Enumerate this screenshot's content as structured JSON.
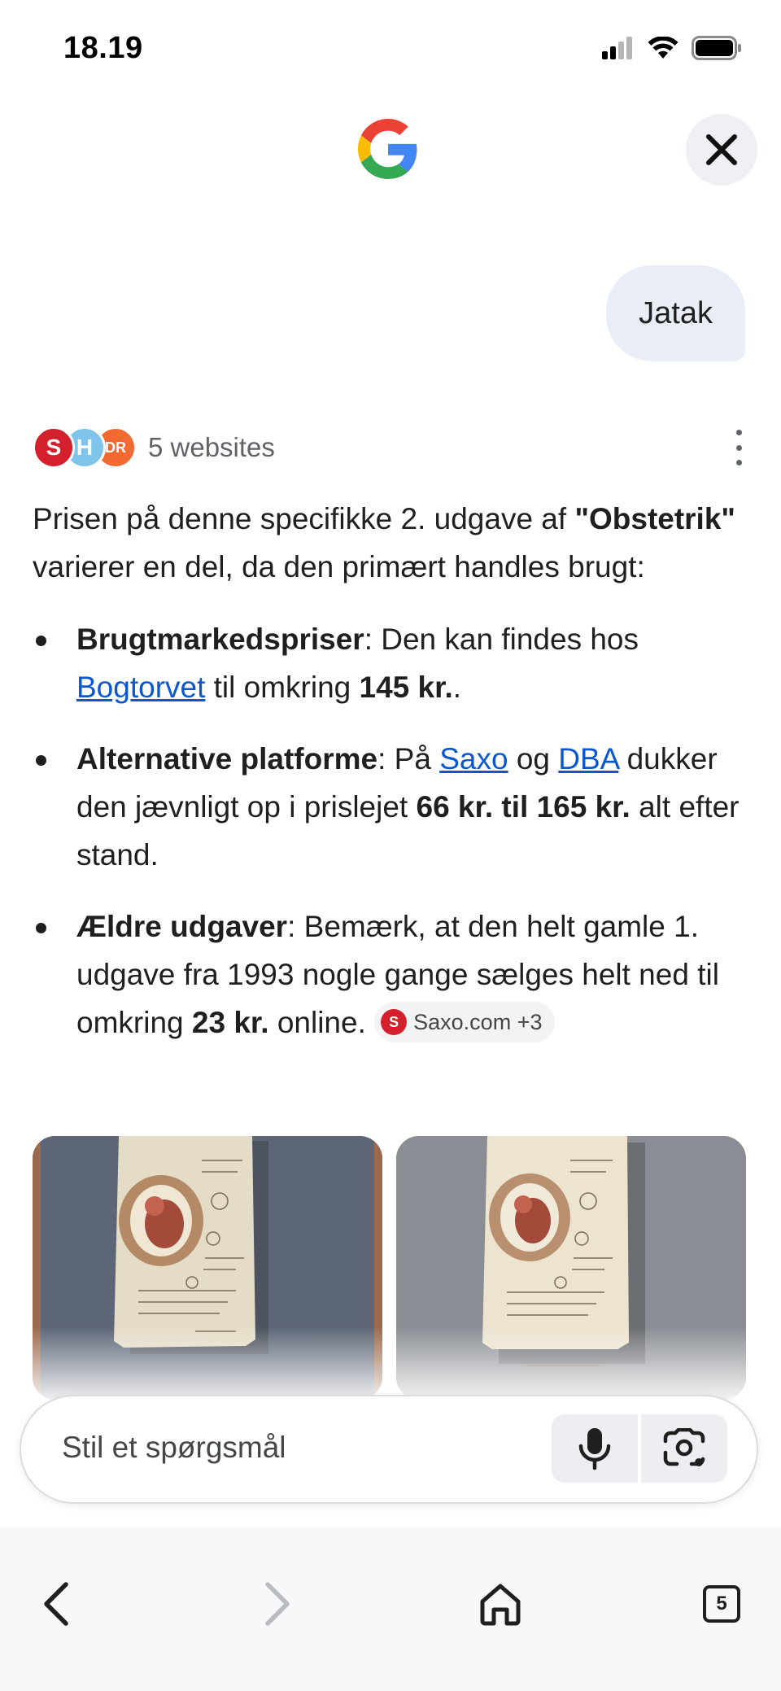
{
  "status_bar": {
    "time": "18.19"
  },
  "user_message": "Jatak",
  "sources": {
    "count_label": "5 websites",
    "icons": [
      "S",
      "H",
      "DR"
    ]
  },
  "answer": {
    "intro": {
      "t1": "Prisen på denne specifikke 2. udgave af ",
      "b1": "\"Obstetrik\"",
      "t2": " varierer en del, da den primært handles brugt:"
    },
    "items": [
      {
        "label": "Brugtmarkedspriser",
        "t1": ": Den kan findes hos ",
        "link1": "Bogtorvet",
        "t2": " til omkring ",
        "b1": "145 kr.",
        "t3": "."
      },
      {
        "label": "Alternative platforme",
        "t1": ": På ",
        "link1": "Saxo",
        "t2": " og ",
        "link2": "DBA",
        "t3": " dukker den jævnligt op i prislejet ",
        "b1": "66 kr. til 165 kr.",
        "t4": " alt efter stand."
      },
      {
        "label": "Ældre udgaver",
        "t1": ": Bemærk, at den helt gamle 1. udgave fra 1993 nogle gange sælges helt ned til omkring ",
        "b1": "23 kr.",
        "t2": " online. "
      }
    ],
    "citation": {
      "icon_letter": "S",
      "label": "Saxo.com +3"
    }
  },
  "search": {
    "placeholder": "Stil et spørgsmål"
  },
  "nav": {
    "tab_count": "5"
  },
  "colors": {
    "link": "#0b57d0",
    "google_blue": "#4285F4",
    "google_red": "#EA4335",
    "google_yellow": "#FBBC05",
    "google_green": "#34A853"
  },
  "icons": [
    "signal-icon",
    "wifi-icon",
    "battery-icon",
    "google-logo",
    "close-icon",
    "more-vert-icon",
    "mic-icon",
    "lens-icon",
    "back-icon",
    "forward-icon",
    "home-icon",
    "tabs-icon"
  ]
}
